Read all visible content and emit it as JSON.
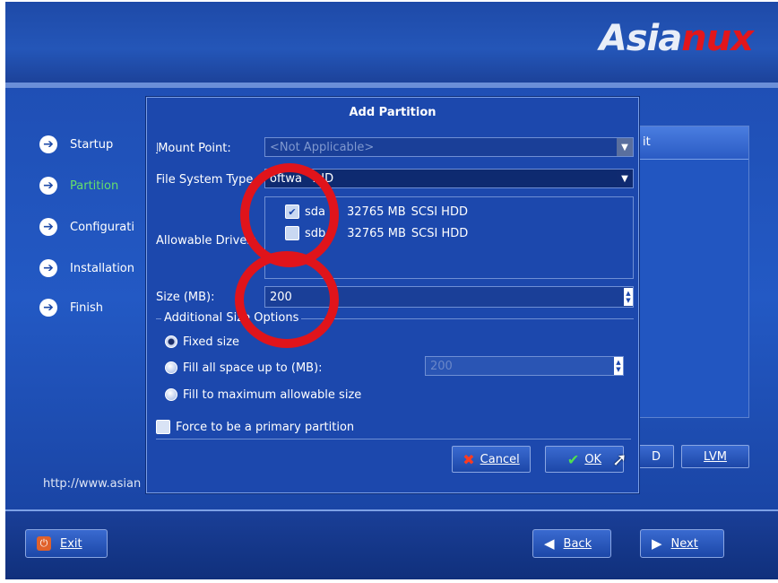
{
  "brand": {
    "logo_left": "Asia",
    "logo_right": "nux"
  },
  "steps": [
    {
      "label": "Startup",
      "active": false
    },
    {
      "label": "Partition",
      "active": true
    },
    {
      "label": "Configurati",
      "active": false
    },
    {
      "label": "Installation",
      "active": false
    },
    {
      "label": "Finish",
      "active": false
    }
  ],
  "url_text": "http://www.asian",
  "background_buttons": {
    "right_header_fragment": "it",
    "partial_button_fragment": "D",
    "lvm": "LVM"
  },
  "footer": {
    "exit": "Exit",
    "back": "Back",
    "next": "Next"
  },
  "dialog": {
    "title": "Add Partition",
    "mount_point_label": "Mount Point:",
    "mount_point_value": "<Not Applicable>",
    "fs_type_label": "File System Type",
    "fs_type_value": "Software RAID",
    "fs_type_visible_left": "oftwa",
    "fs_type_visible_right": "AID",
    "allowable_drives_label": "Allowable Drives:",
    "drives": [
      {
        "name": "sda",
        "size": "32765 MB",
        "model": "SCSI HDD",
        "checked": true
      },
      {
        "name": "sdb",
        "size": "32765 MB",
        "model": "SCSI HDD",
        "checked": false
      }
    ],
    "size_label": "Size (MB):",
    "size_value": "200",
    "additional_size_label": "Additional Size Options",
    "radio_options": [
      {
        "label": "Fixed size",
        "selected": true
      },
      {
        "label": "Fill all space up to (MB):",
        "selected": false
      },
      {
        "label": "Fill to maximum allowable size",
        "selected": false
      }
    ],
    "fill_value": "200",
    "primary_label": "Force to be a primary partition",
    "cancel": "Cancel",
    "ok": "OK"
  },
  "colors": {
    "accent_green": "#66e06a",
    "annotation_red": "#e0141b",
    "dialog_bg": "#1c48ad"
  }
}
